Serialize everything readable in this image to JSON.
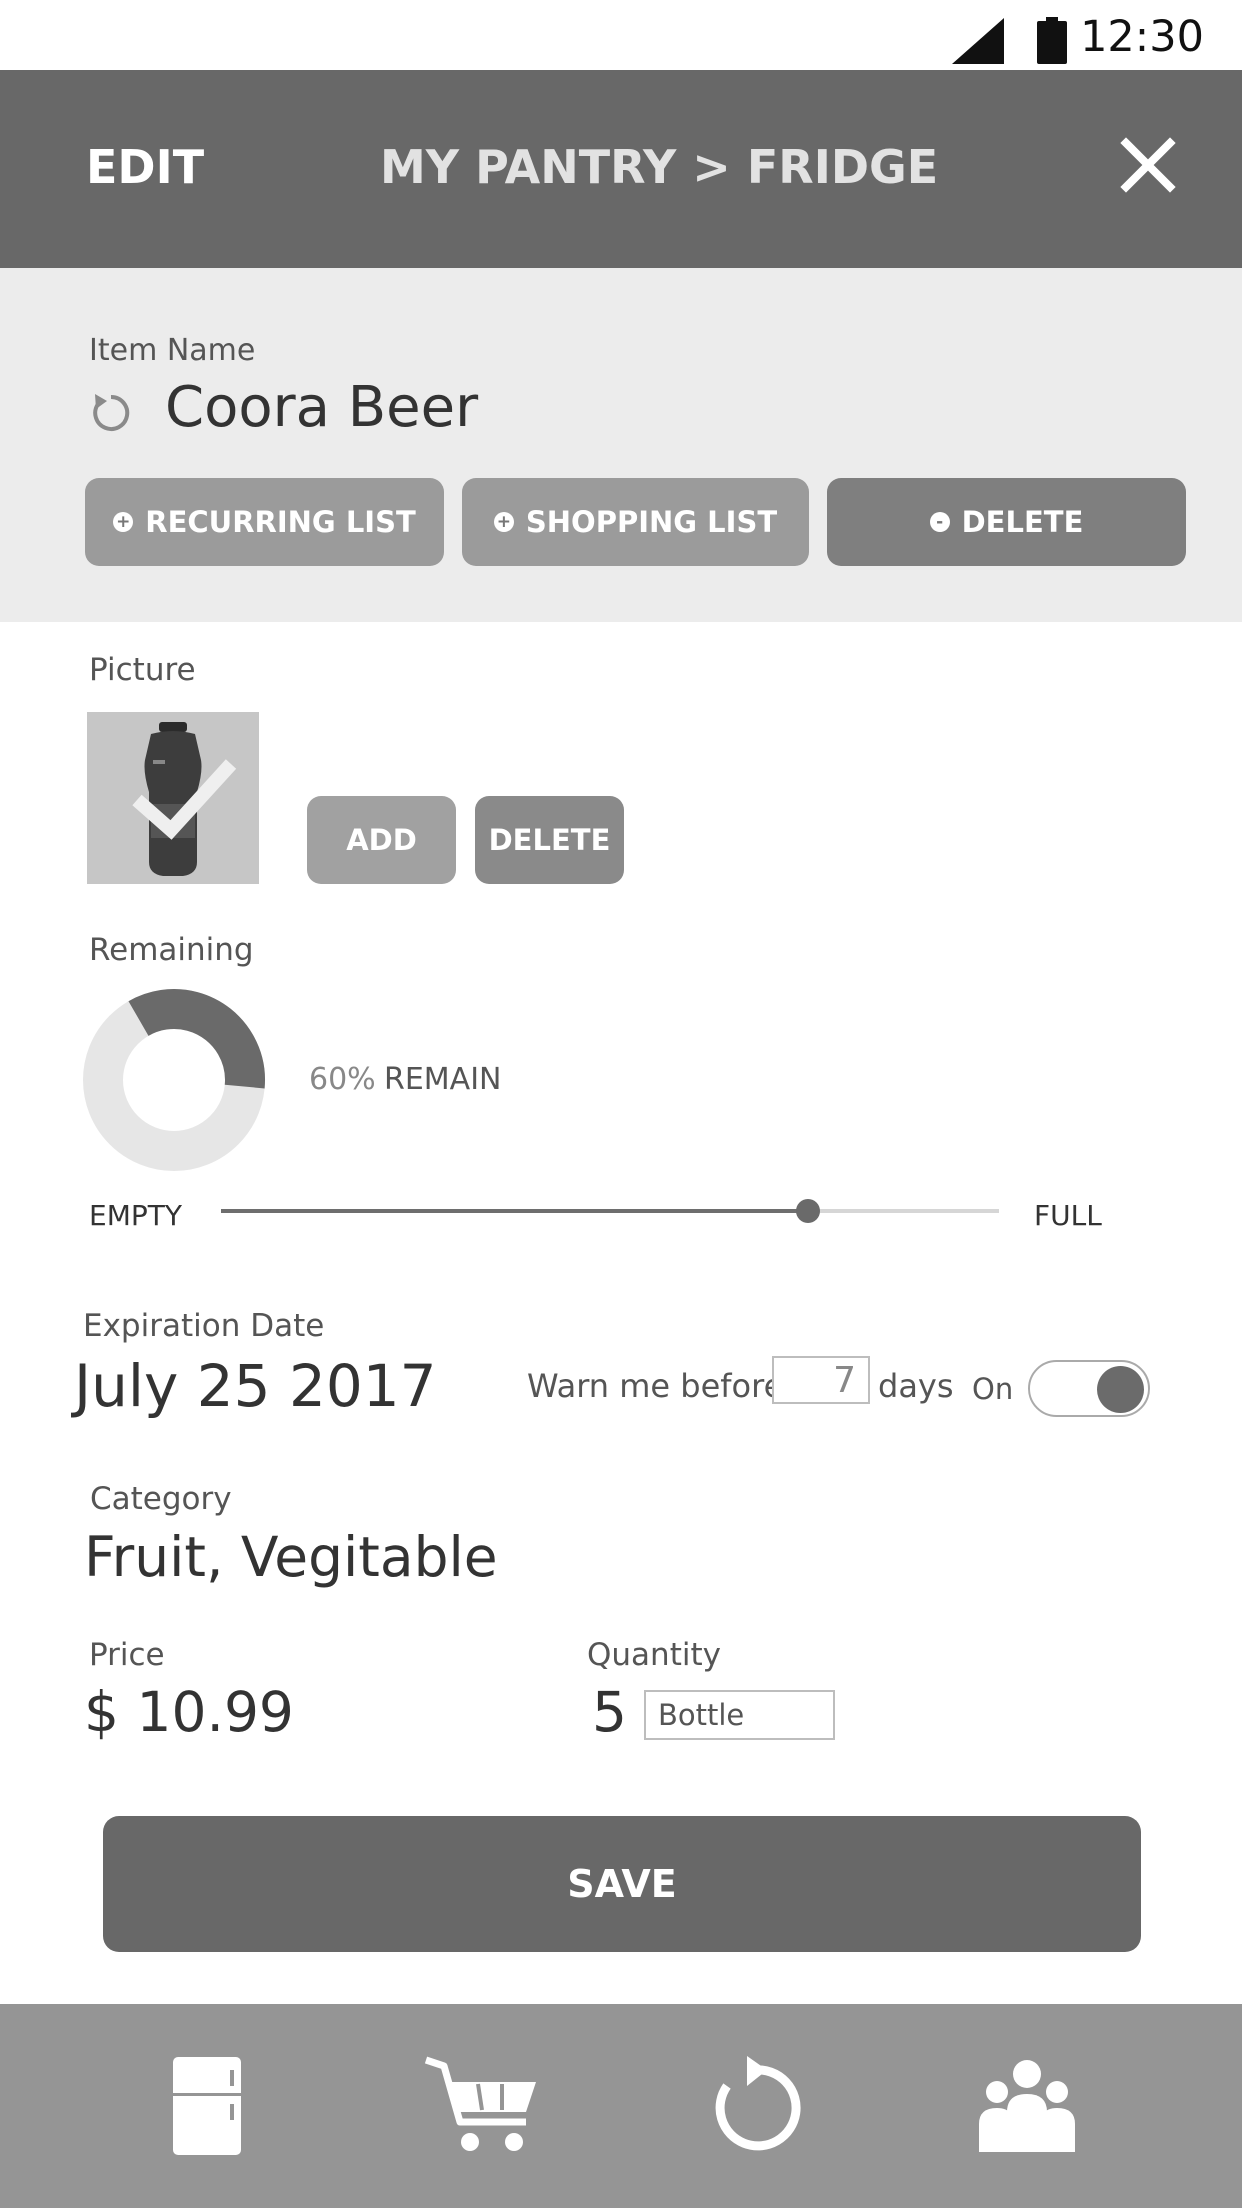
{
  "status_bar": {
    "time": "12:30",
    "icons": [
      "signal-icon",
      "battery-icon"
    ]
  },
  "header": {
    "edit_label": "EDIT",
    "title": "MY PANTRY > FRIDGE",
    "close_icon": "close-icon"
  },
  "item": {
    "name_label": "Item Name",
    "name": "Coora Beer",
    "actions": {
      "recurring_bullet": "+",
      "recurring_label": "RECURRING LIST",
      "shopping_bullet": "+",
      "shopping_label": "SHOPPING LIST",
      "delete_bullet": "-",
      "delete_label": "DELETE"
    }
  },
  "picture": {
    "label": "Picture",
    "add_label": "ADD",
    "delete_label": "DELETE"
  },
  "remaining": {
    "label": "Remaining",
    "percent": 60,
    "percent_text": "60%",
    "remain_text": "REMAIN",
    "empty_label": "EMPTY",
    "full_label": "FULL"
  },
  "expiration": {
    "label": "Expiration Date",
    "date": "July 25 2017",
    "warn_prefix": "Warn me before",
    "warn_days": "7",
    "warn_suffix": "days",
    "toggle_label": "On",
    "toggle_on": true
  },
  "category": {
    "label": "Category",
    "value": "Fruit, Vegitable"
  },
  "price": {
    "label": "Price",
    "value": "$ 10.99"
  },
  "quantity": {
    "label": "Quantity",
    "value": "5",
    "unit": "Bottle"
  },
  "save_label": "SAVE",
  "nav": {
    "items": [
      "fridge-icon",
      "cart-icon",
      "recurring-icon",
      "people-icon"
    ]
  },
  "colors": {
    "header_bg": "#686868",
    "panel_bg": "#ececec",
    "nav_bg": "#959595",
    "accent": "#686868"
  }
}
